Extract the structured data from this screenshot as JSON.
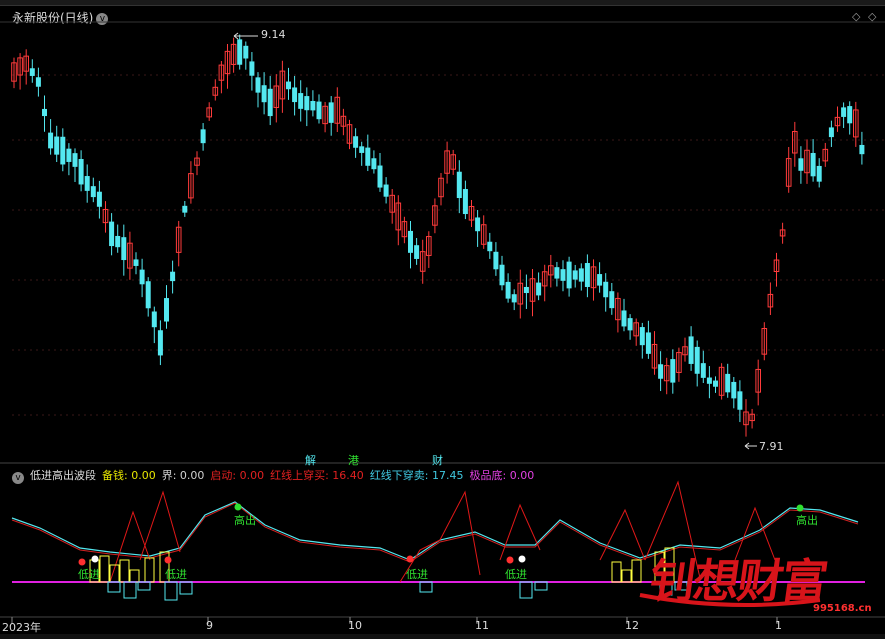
{
  "stock_title": "永新股份(日线)",
  "peak_label": "9.14",
  "low_label": "7.91",
  "markers": [
    "解",
    "港",
    "财"
  ],
  "indicator": {
    "name": "低进高出波段",
    "fields": [
      {
        "label": "备钱: 0.00",
        "color": "#e6e600"
      },
      {
        "label": "界: 0.00",
        "color": "#d0d0d0"
      },
      {
        "label": "启动: 0.00",
        "color": "#e02020"
      },
      {
        "label": "红线上穿买: 16.40",
        "color": "#e02020"
      },
      {
        "label": "红线下穿卖: 17.45",
        "color": "#40c8e0"
      },
      {
        "label": "极品底: 0.00",
        "color": "#e040e0"
      }
    ]
  },
  "signal_labels": {
    "low_in": "低进",
    "high_out": "高出"
  },
  "dates": [
    "2023年",
    "9",
    "10",
    "11",
    "12",
    "1"
  ],
  "watermark": {
    "text": "钊想财富",
    "url": "995168.cn"
  },
  "colors": {
    "up": "#ff3b3b",
    "down": "#54e8f0",
    "magenta": "#e020e0",
    "yellow": "#ffff40",
    "green": "#30e030"
  },
  "chart_data": {
    "type": "candlestick",
    "title": "永新股份(日线)",
    "high_label": 9.14,
    "low_label": 7.91,
    "x_ticks": [
      "2023年",
      "9",
      "10",
      "11",
      "12",
      "1"
    ]
  }
}
